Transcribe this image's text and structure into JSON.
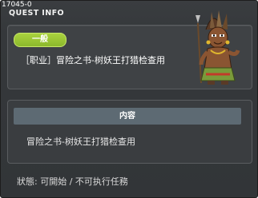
{
  "window": {
    "quest_id": "17045-0",
    "title": "QUEST INFO"
  },
  "quest": {
    "category": "一般",
    "name": "［职业］冒险之书-树妖王打猎检查用",
    "npc_portrait": "tribal-warrior-npc"
  },
  "content": {
    "header": "内容",
    "description": "冒险之书-树妖王打猎检查用"
  },
  "status": {
    "text": "狀態: 可開始 / 不可执行任務"
  },
  "colors": {
    "background": "#35383b",
    "category_badge": "#9bc634",
    "section_header": "#5d6a73"
  }
}
